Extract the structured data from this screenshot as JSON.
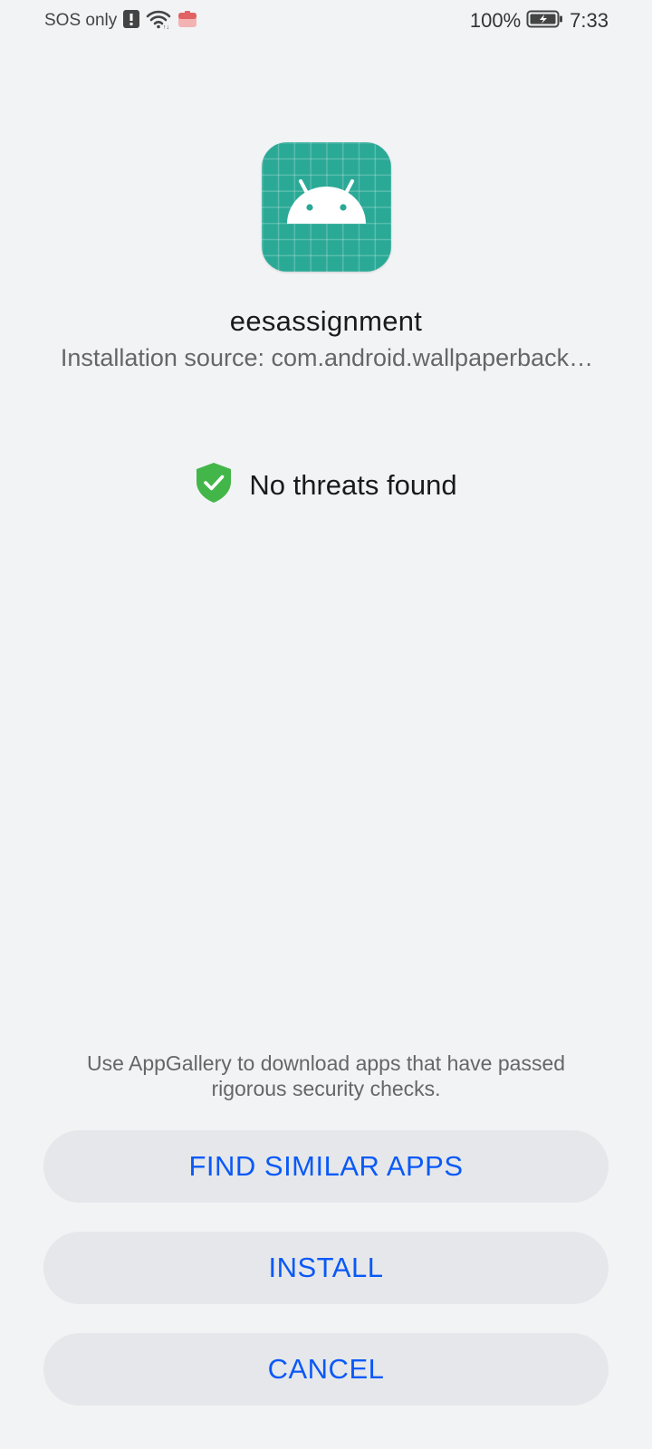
{
  "status_bar": {
    "carrier": "SOS only",
    "battery_percent": "100%",
    "time": "7:33",
    "icons": [
      "alert-sim-icon",
      "wifi-icon",
      "notification-app-icon",
      "battery-charging-icon"
    ]
  },
  "app": {
    "name": "eesassignment",
    "installation_source": "Installation source: com.android.wallpaperback…",
    "icon": "android-app-icon"
  },
  "scan": {
    "result": "No threats found",
    "icon": "shield-check-icon",
    "color": "#43b649"
  },
  "notice": "Use AppGallery to download apps that have passed rigorous security checks.",
  "buttons": {
    "find_similar": "FIND SIMILAR APPS",
    "install": "INSTALL",
    "cancel": "CANCEL"
  },
  "colors": {
    "background": "#f1f3f5",
    "button_bg": "#e5e7ea",
    "accent": "#0a59f7",
    "icon_bg": "#2aa996"
  }
}
